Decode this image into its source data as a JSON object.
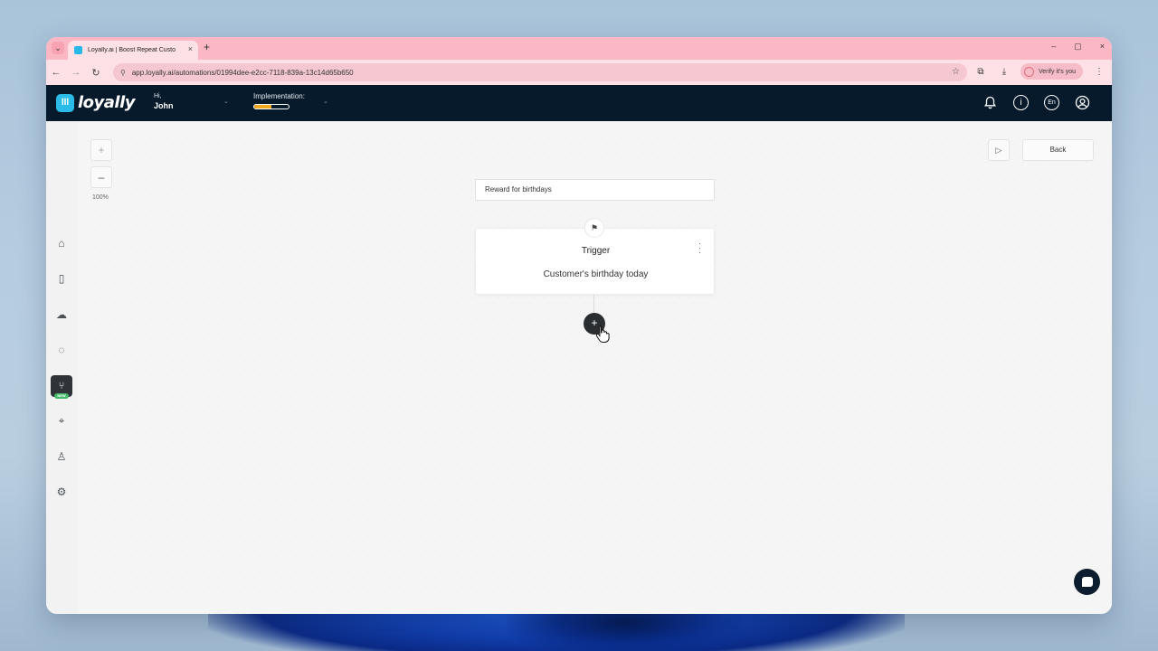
{
  "browser": {
    "tab_title": "Loyally.ai | Boost Repeat Custo",
    "tab_close": "×",
    "new_tab": "+",
    "url": "app.loyally.ai/automations/01994dee-e2cc-7118-839a-13c14d65b650",
    "verify_label": "Verify it's you",
    "window_controls": [
      "–",
      "▢",
      "×"
    ]
  },
  "header": {
    "logo_mark": "lll",
    "logo_text": "loyally",
    "greeting": "Hi,",
    "user_name": "John",
    "implementation_label": "Implementation:",
    "implementation_progress": 0.5,
    "language": "En"
  },
  "canvas": {
    "zoom_in": "+",
    "zoom_out": "–",
    "zoom_level": "100%",
    "back_label": "Back",
    "automation_name": "Reward for birthdays",
    "trigger": {
      "title": "Trigger",
      "description": "Customer's birthday today"
    },
    "add_step": "+"
  },
  "sidebar": {
    "items": [
      {
        "name": "home-icon",
        "glyph": "⌂"
      },
      {
        "name": "device-icon",
        "glyph": "▯"
      },
      {
        "name": "customers-icon",
        "glyph": "☁"
      },
      {
        "name": "messages-icon",
        "glyph": "◌"
      },
      {
        "name": "automations-icon",
        "glyph": "⑂",
        "badge": "NEW"
      },
      {
        "name": "location-icon",
        "glyph": "⌖"
      },
      {
        "name": "user-icon",
        "glyph": "♙"
      },
      {
        "name": "settings-icon",
        "glyph": "⚙"
      }
    ]
  },
  "colors": {
    "header_bg": "#071a2c",
    "accent": "#2bbbe9",
    "progress": "#f0a81e",
    "badge_green": "#43b96a",
    "chrome_tab": "#fbb8c4"
  }
}
